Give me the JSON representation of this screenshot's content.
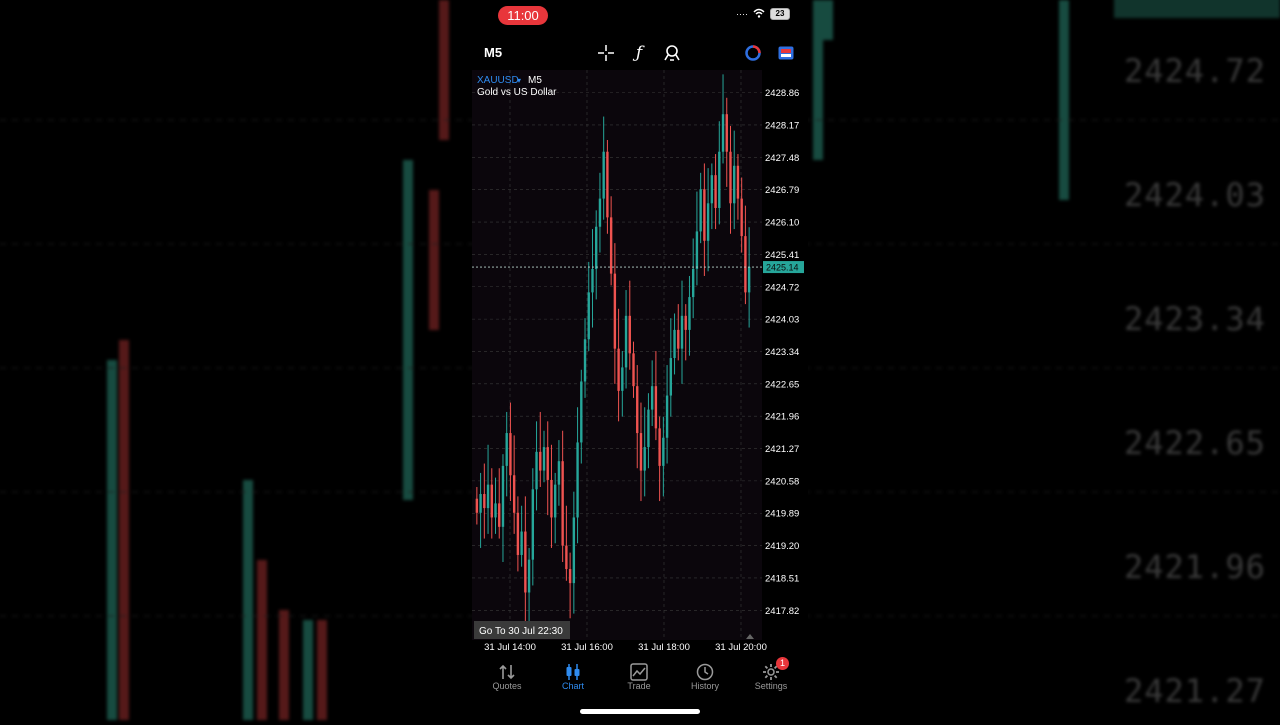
{
  "background": {
    "price_labels": [
      "2424.72",
      "2424.03",
      "2423.34",
      "2422.65",
      "2421.96",
      "2421.27"
    ]
  },
  "status_bar": {
    "time": "11:00",
    "battery": "23"
  },
  "toolbar": {
    "timeframe": "M5"
  },
  "chart_data": {
    "type": "candlestick",
    "symbol": "XAUUSD",
    "timeframe": "M5",
    "description": "Gold vs US Dollar",
    "y_ticks": [
      "2428.86",
      "2428.17",
      "2427.48",
      "2426.79",
      "2426.10",
      "2425.41",
      "2424.72",
      "2424.03",
      "2423.34",
      "2422.65",
      "2421.96",
      "2421.27",
      "2420.58",
      "2419.89",
      "2419.20",
      "2418.51",
      "2417.82"
    ],
    "ylim": [
      2417.4,
      2429.3
    ],
    "x_ticks": [
      "31 Jul 14:00",
      "31 Jul 16:00",
      "31 Jul 18:00",
      "31 Jul 20:00"
    ],
    "current_price": "2425.14",
    "goto_label": "Go To 30 Jul 22:30",
    "up_color": "#26a69a",
    "down_color": "#ef5350",
    "close": [
      2419.9,
      2420.3,
      2420.0,
      2420.5,
      2419.8,
      2420.1,
      2419.6,
      2420.9,
      2421.6,
      2420.7,
      2419.9,
      2419.0,
      2419.5,
      2418.2,
      2418.9,
      2420.4,
      2421.2,
      2420.8,
      2421.3,
      2420.6,
      2419.8,
      2420.5,
      2421.0,
      2419.2,
      2418.7,
      2418.4,
      2419.8,
      2421.4,
      2422.7,
      2423.6,
      2424.6,
      2425.1,
      2426.0,
      2426.6,
      2427.6,
      2426.2,
      2425.0,
      2423.4,
      2422.5,
      2423.0,
      2424.1,
      2423.3,
      2422.6,
      2421.6,
      2420.8,
      2421.3,
      2422.1,
      2422.6,
      2421.7,
      2420.9,
      2421.5,
      2422.4,
      2423.2,
      2423.8,
      2423.4,
      2424.1,
      2423.8,
      2424.5,
      2425.1,
      2425.9,
      2426.8,
      2425.7,
      2426.5,
      2427.1,
      2426.4,
      2427.6,
      2428.4,
      2427.6,
      2426.5,
      2427.3,
      2426.6,
      2425.8,
      2424.6,
      2425.14
    ]
  },
  "tabs": [
    {
      "label": "Quotes"
    },
    {
      "label": "Chart"
    },
    {
      "label": "Trade"
    },
    {
      "label": "History"
    },
    {
      "label": "Settings",
      "badge": "1"
    }
  ]
}
